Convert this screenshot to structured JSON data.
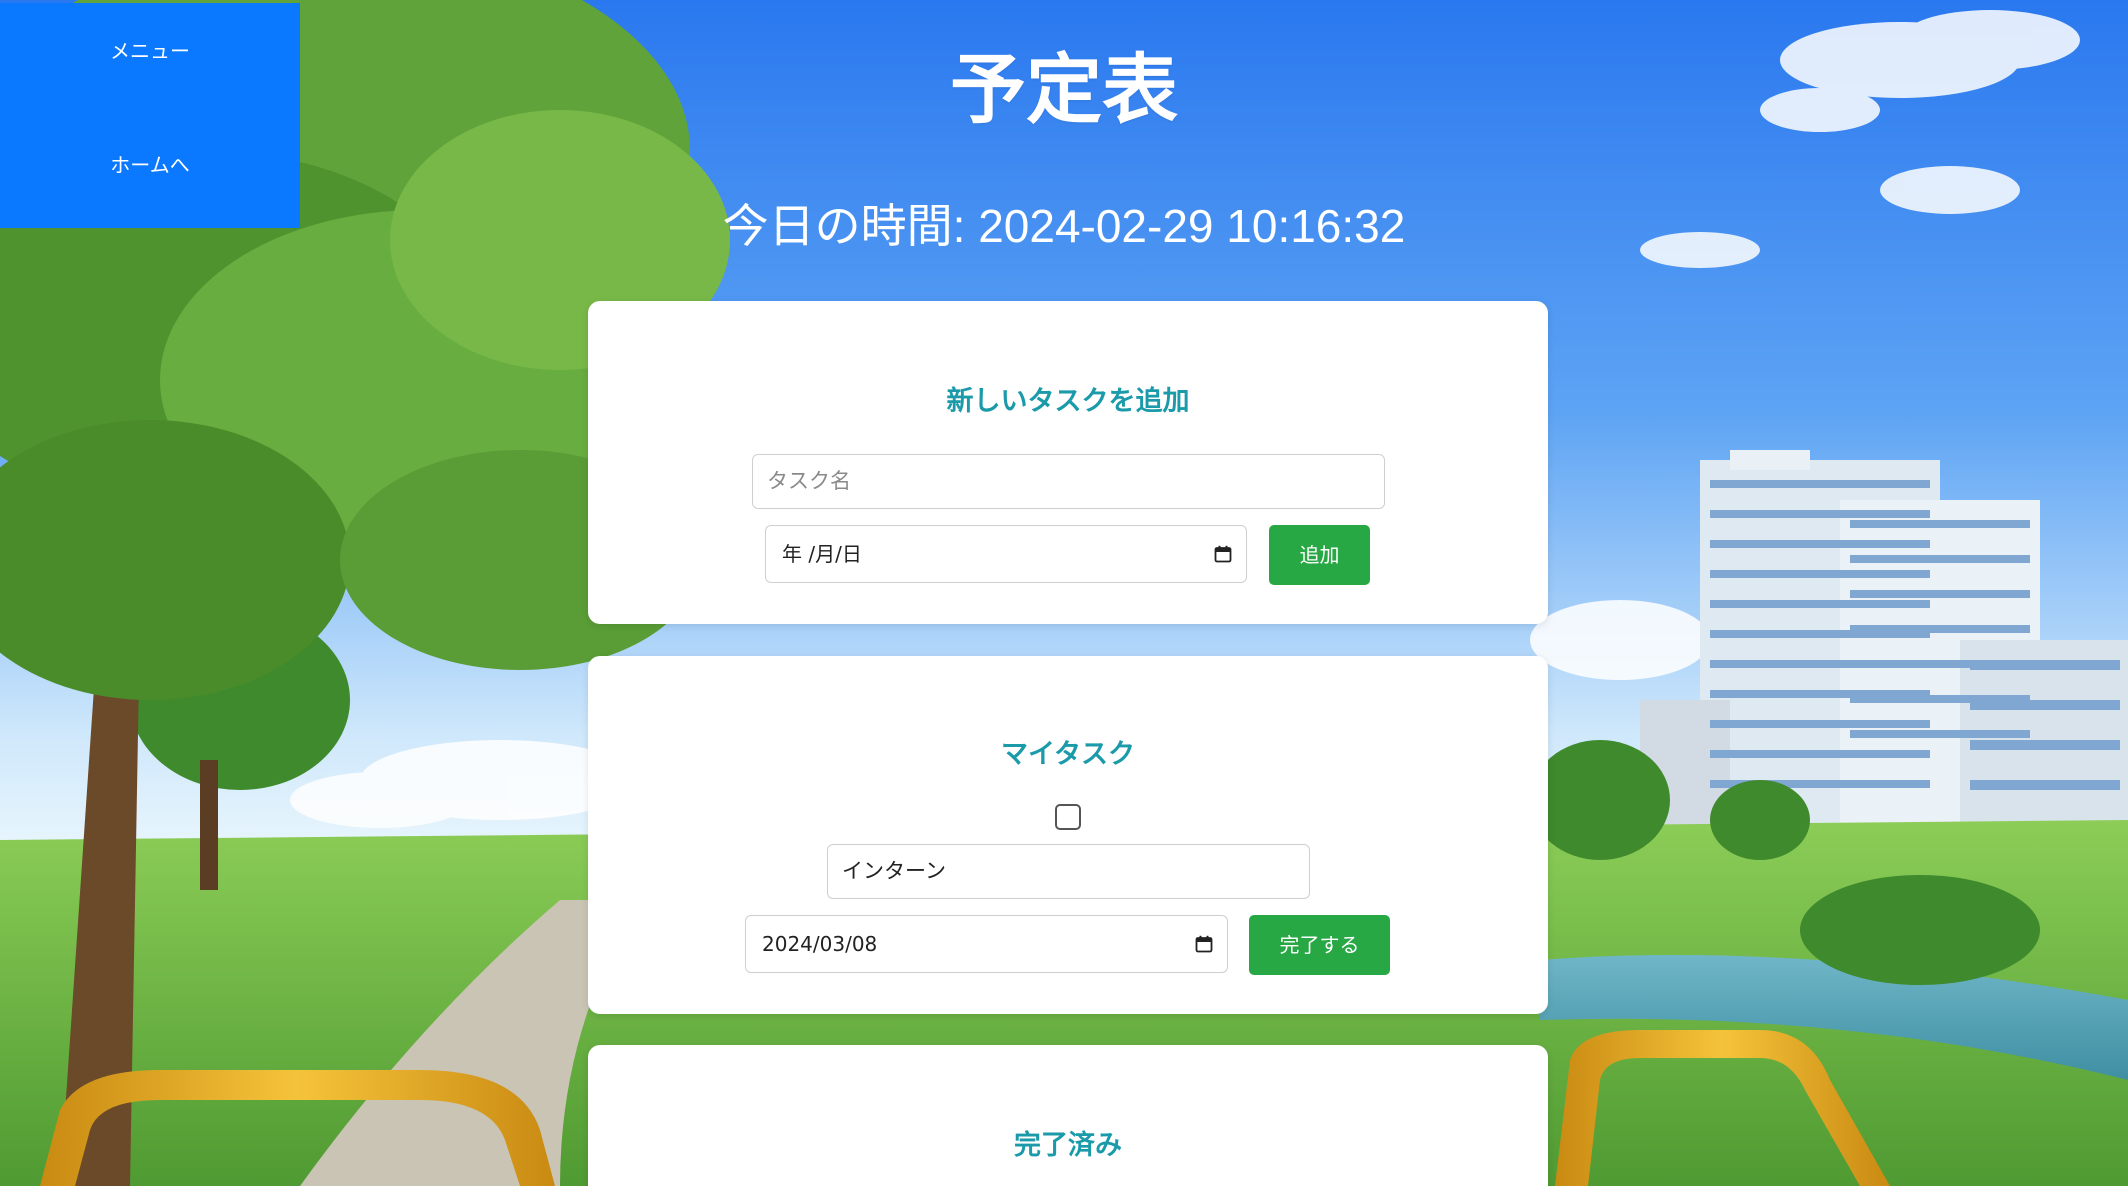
{
  "sidebar": {
    "menu_label": "メニュー",
    "home_label": "ホームへ"
  },
  "header": {
    "title": "予定表",
    "clock_label": "今日の時間: 2024-02-29 10:16:32"
  },
  "add_task": {
    "heading": "新しいタスクを追加",
    "name_placeholder": "タスク名",
    "date_placeholder": "年 /月/日",
    "add_button": "追加"
  },
  "my_tasks": {
    "heading": "マイタスク",
    "items": [
      {
        "checked": false,
        "name": "インターン",
        "date": "2024/03/08",
        "complete_button": "完了する"
      }
    ]
  },
  "completed": {
    "heading": "完了済み"
  },
  "colors": {
    "sidebar": "#0a78ff",
    "heading_teal": "#1b9aaa",
    "button_green": "#28a745"
  },
  "icons": {
    "date_picker": "calendar-icon"
  }
}
